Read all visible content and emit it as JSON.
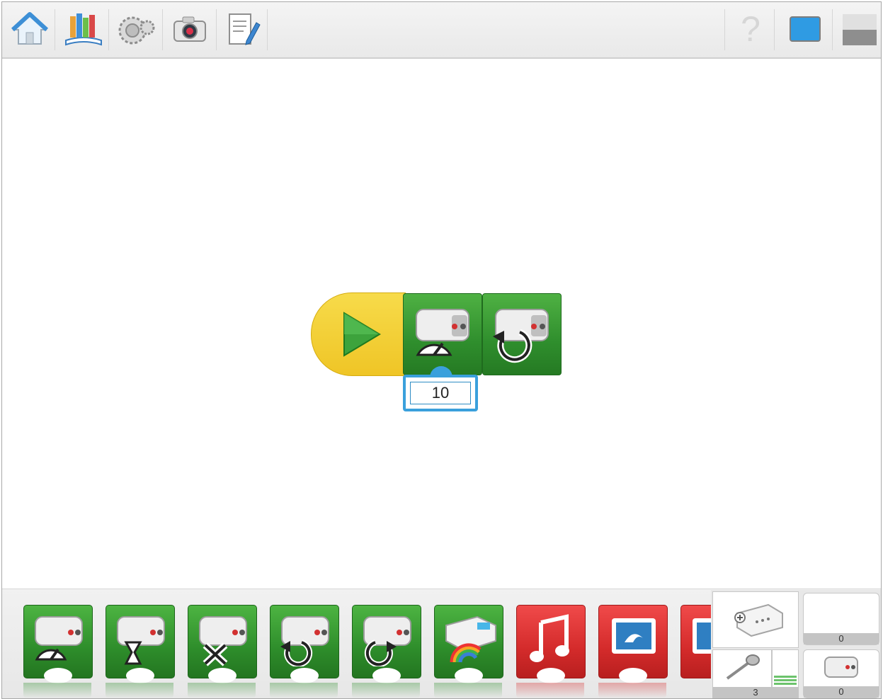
{
  "toolbar": {
    "left_buttons": [
      "home-icon",
      "lobby-books-icon",
      "gears-icon",
      "camera-icon",
      "document-pencil-icon"
    ],
    "right_buttons": [
      "help-icon",
      "screen-icon",
      "panel-toggle-icon"
    ]
  },
  "program": {
    "start": "start-block-play-icon",
    "blocks": [
      "motor-power-block",
      "motor-direction-block"
    ],
    "power_value": "10"
  },
  "palette": {
    "blocks": [
      {
        "name": "motor-power",
        "color": "green"
      },
      {
        "name": "motor-on-for",
        "color": "green"
      },
      {
        "name": "motor-off",
        "color": "green"
      },
      {
        "name": "motor-direction-left",
        "color": "green"
      },
      {
        "name": "motor-direction-right",
        "color": "green"
      },
      {
        "name": "hub-light",
        "color": "green"
      },
      {
        "name": "play-sound",
        "color": "red"
      },
      {
        "name": "display-background",
        "color": "red"
      },
      {
        "name": "display-text",
        "color": "red"
      }
    ]
  },
  "devices": {
    "hub_count": "0",
    "sensor_count": "3",
    "motor_count": "0"
  },
  "colors": {
    "start_yellow": "#efc526",
    "action_green": "#2f8e2d",
    "sound_red": "#d42b2b",
    "input_blue": "#3aa0dc"
  }
}
